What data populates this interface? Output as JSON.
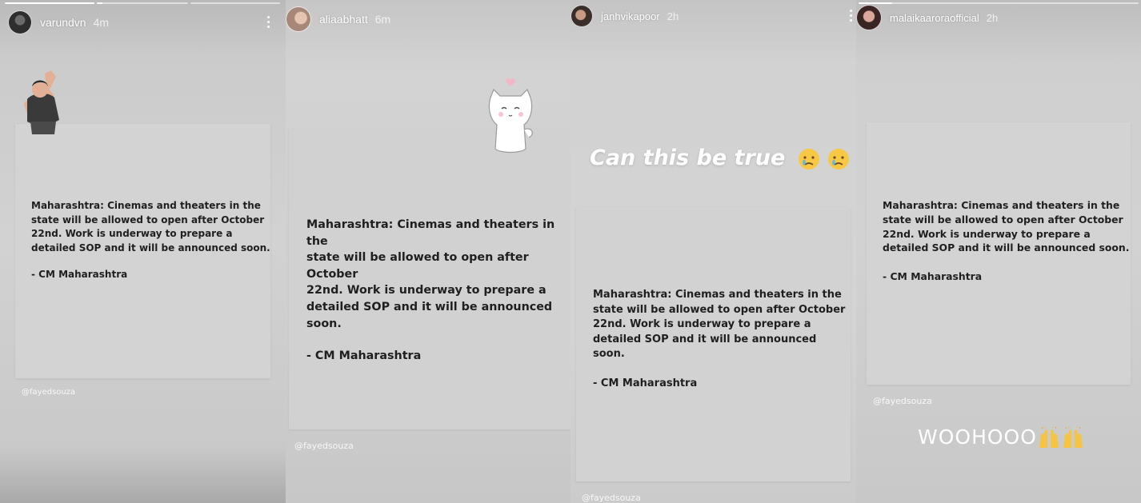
{
  "stories": [
    {
      "username": "varundvn",
      "time": "4m",
      "card_lines": [
        "Maharashtra: Cinemas and theaters in the",
        "state will be allowed to open after October",
        "22nd.  Work is underway to prepare a",
        "detailed SOP and it will be announced soon."
      ],
      "signature": "- CM Maharashtra",
      "credit": "@fayedsouza",
      "sticker": "dancing-man-sticker"
    },
    {
      "username": "aliaabhatt",
      "time": "6m",
      "card_lines": [
        "Maharashtra: Cinemas and theaters in the",
        "state will be allowed to open after October",
        "22nd.  Work is underway to prepare a",
        "detailed SOP and it will be announced soon."
      ],
      "signature": "- CM Maharashtra",
      "credit": "@fayedsouza",
      "sticker": "white-cat-heart-sticker"
    },
    {
      "username": "janhvikapoor",
      "time": "2h",
      "caption": "Can this be true",
      "caption_emoji": "crying-face-emoji x2",
      "card_lines": [
        "Maharashtra: Cinemas and theaters in the",
        "state will be allowed to open after October",
        "22nd.  Work is underway to prepare a",
        "detailed SOP and it will be announced soon."
      ],
      "signature": "- CM Maharashtra",
      "credit": "@fayedsouza"
    },
    {
      "username": "malaikaaroraofficial",
      "time": "2h",
      "card_lines": [
        "Maharashtra: Cinemas and theaters in the",
        "state will be allowed to open after October",
        "22nd.  Work is underway to prepare a",
        "detailed SOP and it will be announced soon."
      ],
      "signature": "- CM Maharashtra",
      "credit": "@fayedsouza",
      "caption": "WOOHOOO",
      "caption_emoji": "raising-hands-emoji x2"
    }
  ],
  "colors": {
    "story_bg": "#cfcfcf",
    "card_bg": "#d3d3d3",
    "card_text": "#1f1f1f",
    "header_text": "#ffffff"
  }
}
